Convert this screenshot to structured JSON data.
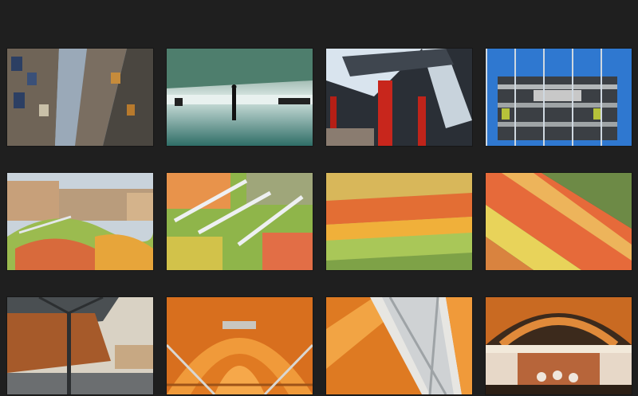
{
  "gallery": {
    "background": "#1f1f1f",
    "photos": [
      {
        "subject": "curved-modern-facade"
      },
      {
        "subject": "glass-hall-silhouettes"
      },
      {
        "subject": "red-columns-canopy"
      },
      {
        "subject": "blue-glass-building"
      },
      {
        "subject": "mosaic-roof-city-view"
      },
      {
        "subject": "mosaic-roof-steel-arches"
      },
      {
        "subject": "mosaic-roof-closeup"
      },
      {
        "subject": "mosaic-roof-diagonal"
      },
      {
        "subject": "market-entrance-canopy"
      },
      {
        "subject": "wooden-vault-ceiling"
      },
      {
        "subject": "wooden-ceiling-truss"
      },
      {
        "subject": "market-interior-stalls"
      }
    ]
  }
}
